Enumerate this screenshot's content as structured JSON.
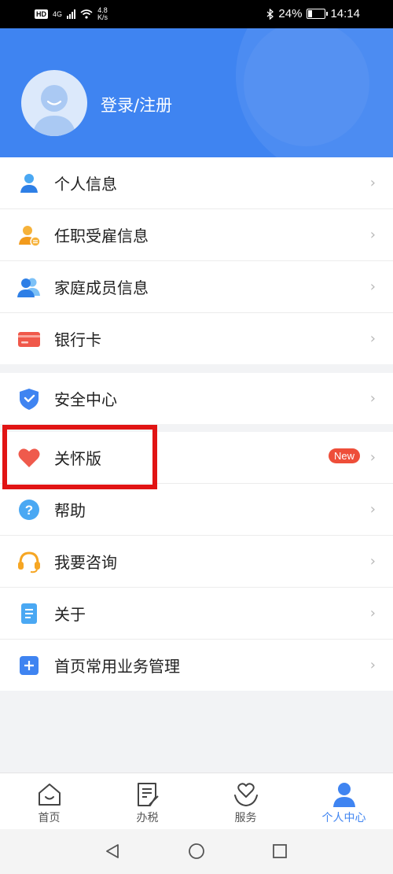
{
  "status_bar": {
    "hd": "HD",
    "network": "4G",
    "speed_value": "4.8",
    "speed_unit": "K/s",
    "battery": "24%",
    "time": "14:14"
  },
  "header": {
    "login_text": "登录/注册"
  },
  "menu_group_1": [
    {
      "label": "个人信息",
      "icon": "person-icon"
    },
    {
      "label": "任职受雇信息",
      "icon": "employee-icon"
    },
    {
      "label": "家庭成员信息",
      "icon": "family-icon"
    },
    {
      "label": "银行卡",
      "icon": "bank-card-icon"
    }
  ],
  "menu_group_2": [
    {
      "label": "安全中心",
      "icon": "shield-icon"
    }
  ],
  "menu_group_3": [
    {
      "label": "关怀版",
      "icon": "heart-icon",
      "badge": "New"
    },
    {
      "label": "帮助",
      "icon": "help-icon"
    },
    {
      "label": "我要咨询",
      "icon": "headset-icon"
    },
    {
      "label": "关于",
      "icon": "document-icon"
    },
    {
      "label": "首页常用业务管理",
      "icon": "add-square-icon"
    }
  ],
  "bottom_nav": [
    {
      "label": "首页",
      "icon": "home-icon",
      "active": false
    },
    {
      "label": "办税",
      "icon": "tax-form-icon",
      "active": false
    },
    {
      "label": "服务",
      "icon": "service-heart-icon",
      "active": false
    },
    {
      "label": "个人中心",
      "icon": "person-center-icon",
      "active": true
    }
  ],
  "colors": {
    "primary": "#3f84f1",
    "highlight": "#e11414",
    "badge": "#ee4e39"
  }
}
